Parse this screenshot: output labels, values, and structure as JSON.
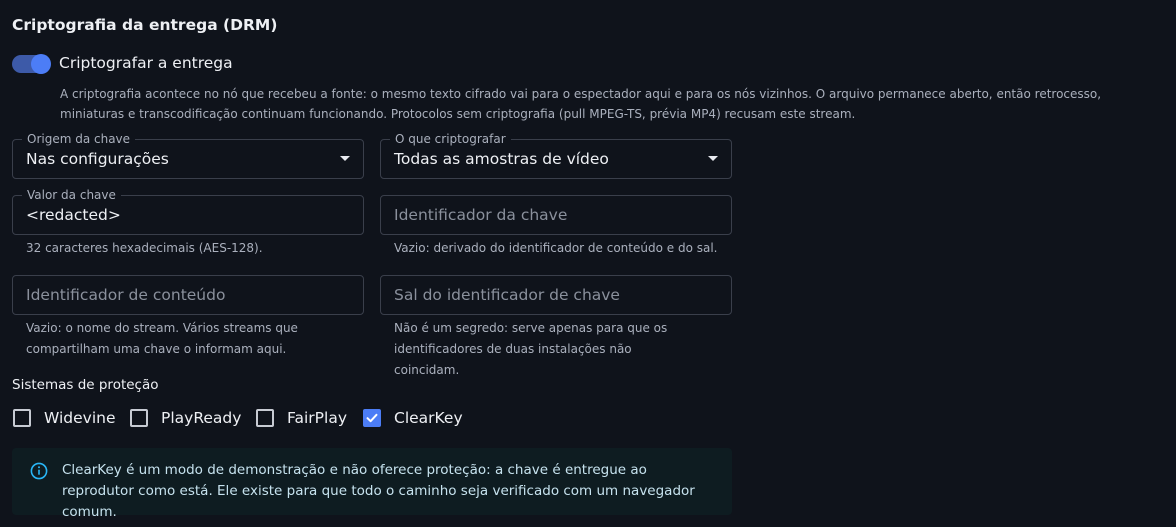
{
  "section": {
    "title": "Criptografia da entrega (DRM)"
  },
  "toggle": {
    "label": "Criptografar a entrega",
    "on": true,
    "description": "A criptografia acontece no nó que recebeu a fonte: o mesmo texto cifrado vai para o espectador aqui e para os nós vizinhos. O arquivo permanece aberto, então retrocesso, miniaturas e transcodificação continuam funcionando. Protocolos sem criptografia (pull MPEG-TS, prévia MP4) recusam este stream."
  },
  "fields": {
    "key_source": {
      "label": "Origem da chave",
      "value": "Nas configurações"
    },
    "what_to_encrypt": {
      "label": "O que criptografar",
      "value": "Todas as amostras de vídeo"
    },
    "key_value": {
      "label": "Valor da chave",
      "value": "<redacted>",
      "helper": "32 caracteres hexadecimais (AES-128)."
    },
    "key_id": {
      "placeholder": "Identificador da chave",
      "helper": "Vazio: derivado do identificador de conteúdo e do sal."
    },
    "content_id": {
      "placeholder": "Identificador de conteúdo",
      "helper": "Vazio: o nome do stream. Vários streams que compartilham uma chave o informam aqui."
    },
    "key_id_salt": {
      "placeholder": "Sal do identificador de chave",
      "helper": "Não é um segredo: serve apenas para que os identificadores de duas instalações não coincidam."
    }
  },
  "protection": {
    "title": "Sistemas de proteção",
    "systems": [
      {
        "label": "Widevine",
        "checked": false
      },
      {
        "label": "PlayReady",
        "checked": false
      },
      {
        "label": "FairPlay",
        "checked": false
      },
      {
        "label": "ClearKey",
        "checked": true
      }
    ]
  },
  "alert": {
    "icon": "info-icon",
    "text": "ClearKey é um modo de demonstração e não oferece proteção: a chave é entregue ao reprodutor como está. Ele existe para que todo o caminho seja verificado com um navegador comum."
  },
  "colors": {
    "background": "#0f131b",
    "accent": "#4c7df6",
    "alert_background": "#0e1c21",
    "alert_icon": "#29b6f6"
  }
}
